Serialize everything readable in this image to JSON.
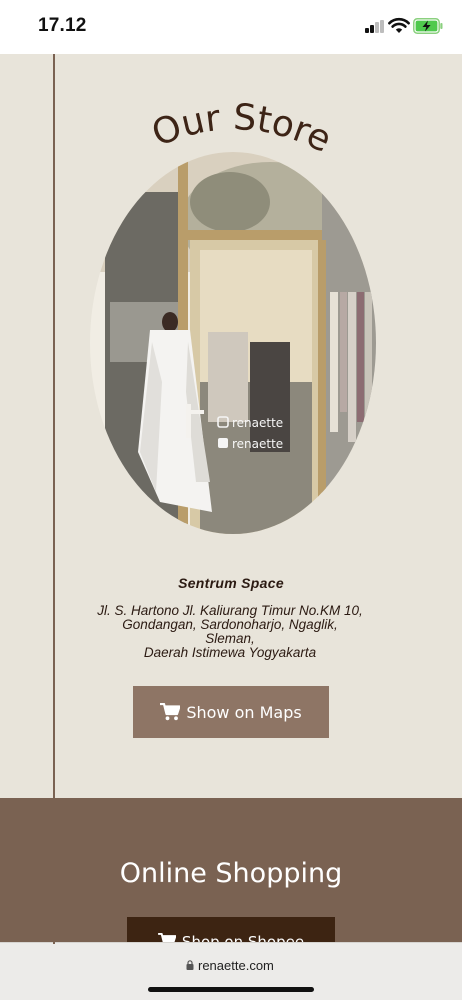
{
  "status_bar": {
    "time": "17.12"
  },
  "store": {
    "title": "Our Store",
    "name": "Sentrum Space",
    "address_lines": [
      "Jl. S. Hartono Jl. Kaliurang Timur No.KM 10,",
      "Gondangan, Sardonoharjo, Ngaglik,",
      "Sleman,",
      "Daerah Istimewa Yogyakarta"
    ],
    "photo_sign_texts": [
      "renaette",
      "renaette"
    ],
    "maps_button_label": "Show on Maps"
  },
  "online": {
    "title": "Online Shopping",
    "shopee_button_label": "Shop on Shopee"
  },
  "browser": {
    "url": "renaette.com"
  },
  "colors": {
    "page_background": "#e8e4da",
    "accent_brown": "#7a6252",
    "maps_button": "#8e7565",
    "shopee_button": "#3d2412",
    "title_text": "#3d2416"
  }
}
